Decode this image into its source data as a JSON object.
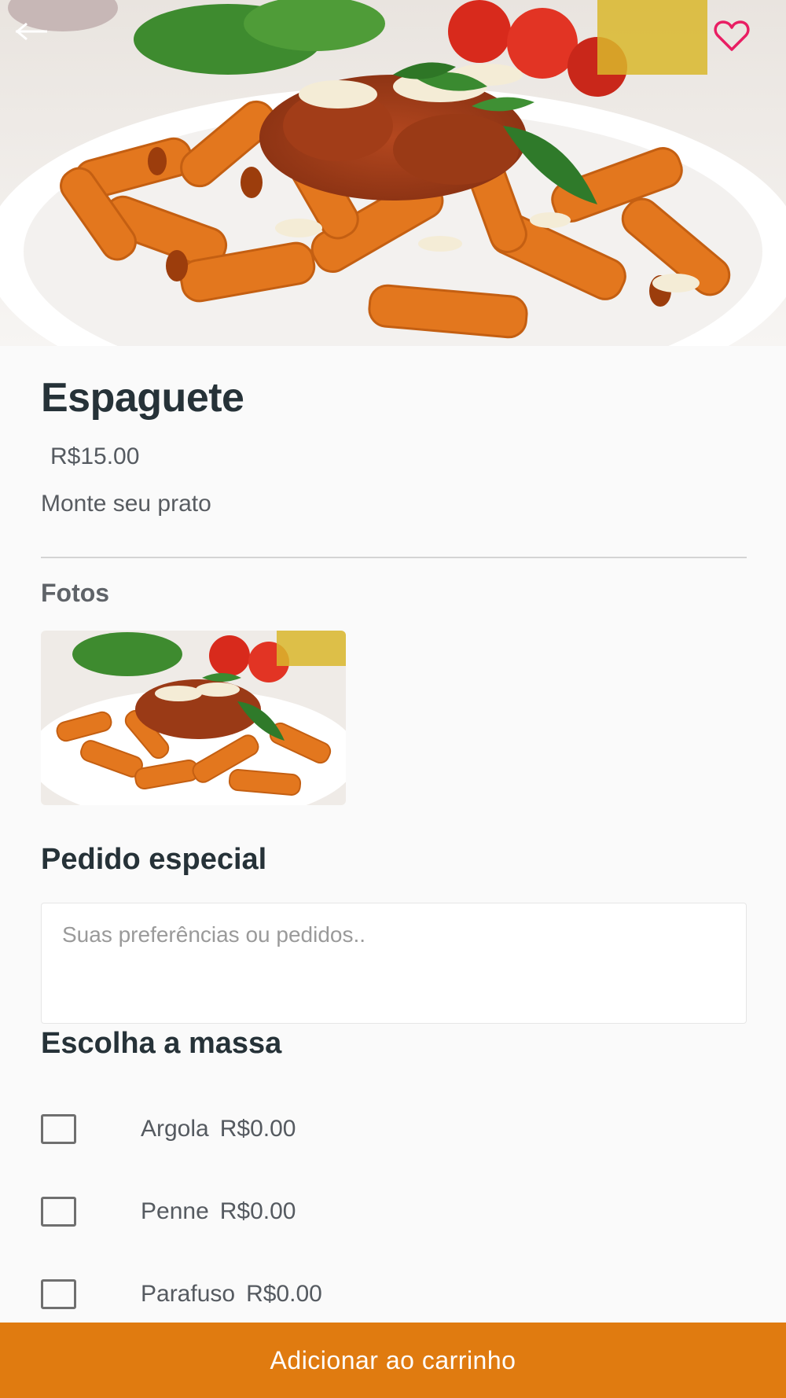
{
  "product": {
    "name": "Espaguete",
    "price": "R$15.00",
    "description": "Monte seu prato"
  },
  "photos": {
    "title": "Fotos"
  },
  "special_request": {
    "title": "Pedido especial",
    "placeholder": "Suas preferências ou pedidos..",
    "value": ""
  },
  "pasta_choice": {
    "title": "Escolha a massa",
    "options": [
      {
        "label": "Argola",
        "price": "R$0.00",
        "checked": false
      },
      {
        "label": "Penne",
        "price": "R$0.00",
        "checked": false
      },
      {
        "label": "Parafuso",
        "price": "R$0.00",
        "checked": false
      }
    ]
  },
  "cart_button": {
    "label": "Adicionar ao carrinho"
  },
  "icons": {
    "back": "arrow-left-icon",
    "favorite": "heart-outline-icon"
  },
  "colors": {
    "accent": "#e07b10",
    "favorite": "#e91e63",
    "heading": "#263238"
  }
}
